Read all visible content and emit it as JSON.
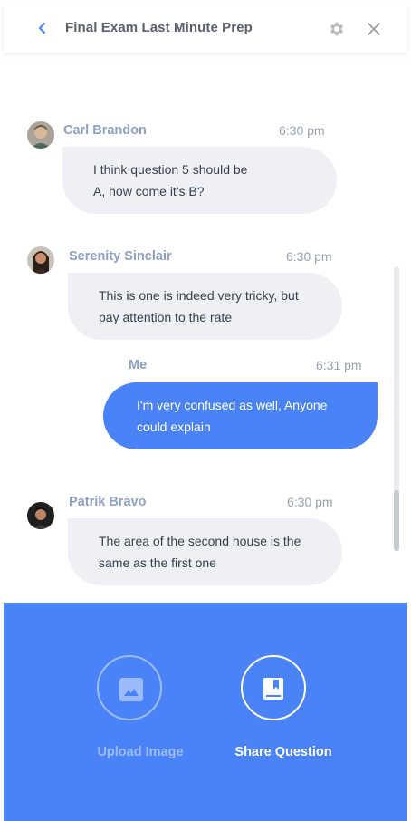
{
  "header": {
    "title": "Final Exam Last Minute Prep",
    "back_icon": "chevron-left-icon",
    "settings_icon": "gear-icon",
    "close_icon": "close-icon"
  },
  "messages": [
    {
      "sender": "Carl Brandon",
      "time": "6:30 pm",
      "text": "I think question 5 should be\nA, how come it's B?"
    },
    {
      "sender": "Serenity Sinclair",
      "time": "6:30 pm",
      "text": "This is one is indeed very tricky, but\npay attention to the rate"
    },
    {
      "sender": "Me",
      "time": "6:31 pm",
      "text": "I'm very confused as well, Anyone\ncould explain"
    },
    {
      "sender": "Patrik Bravo",
      "time": "6:30 pm",
      "text": "The area of the second house is the\nsame as the first one"
    }
  ],
  "actions": {
    "upload_label": "Upload Image",
    "share_label": "Share Question"
  },
  "colors": {
    "accent": "#4a82f7",
    "bubble": "#eef0f5",
    "name": "#8ea1c4"
  }
}
